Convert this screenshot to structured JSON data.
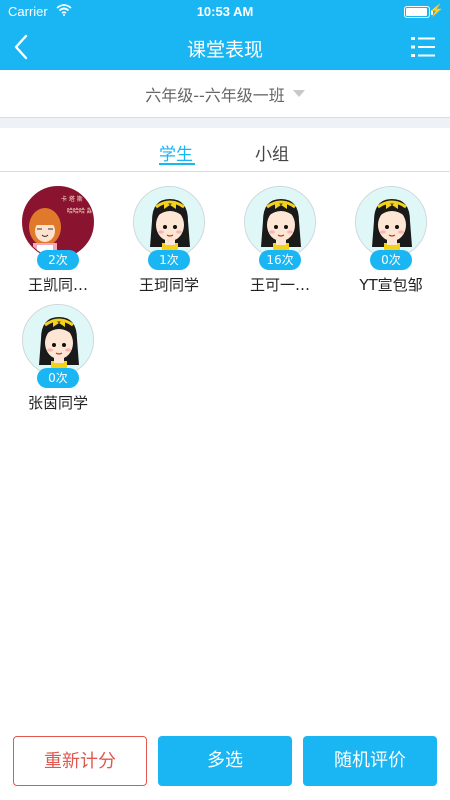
{
  "status_bar": {
    "carrier": "Carrier",
    "time": "10:53 AM",
    "wifi_icon": "wifi-icon",
    "battery_icon": "battery-icon"
  },
  "nav": {
    "title": "课堂表现",
    "back_icon": "chevron-left-icon",
    "menu_icon": "list-menu-icon"
  },
  "class_selector": {
    "label": "六年级--六年级一班",
    "caret_icon": "caret-down-icon"
  },
  "tabs": [
    {
      "label": "学生",
      "active": true
    },
    {
      "label": "小组",
      "active": false
    }
  ],
  "students": [
    {
      "name": "王凯同…",
      "count": "2次",
      "avatar": "photo"
    },
    {
      "name": "王珂同学",
      "count": "1次",
      "avatar": "default"
    },
    {
      "name": "王可一…",
      "count": "16次",
      "avatar": "default"
    },
    {
      "name": "YT宣包邹",
      "count": "0次",
      "avatar": "default"
    },
    {
      "name": "张茵同学",
      "count": "0次",
      "avatar": "default"
    }
  ],
  "footer": {
    "reset": "重新计分",
    "multi_select": "多选",
    "random": "随机评价"
  },
  "colors": {
    "accent": "#1ab6f3",
    "danger": "#e0584f"
  }
}
